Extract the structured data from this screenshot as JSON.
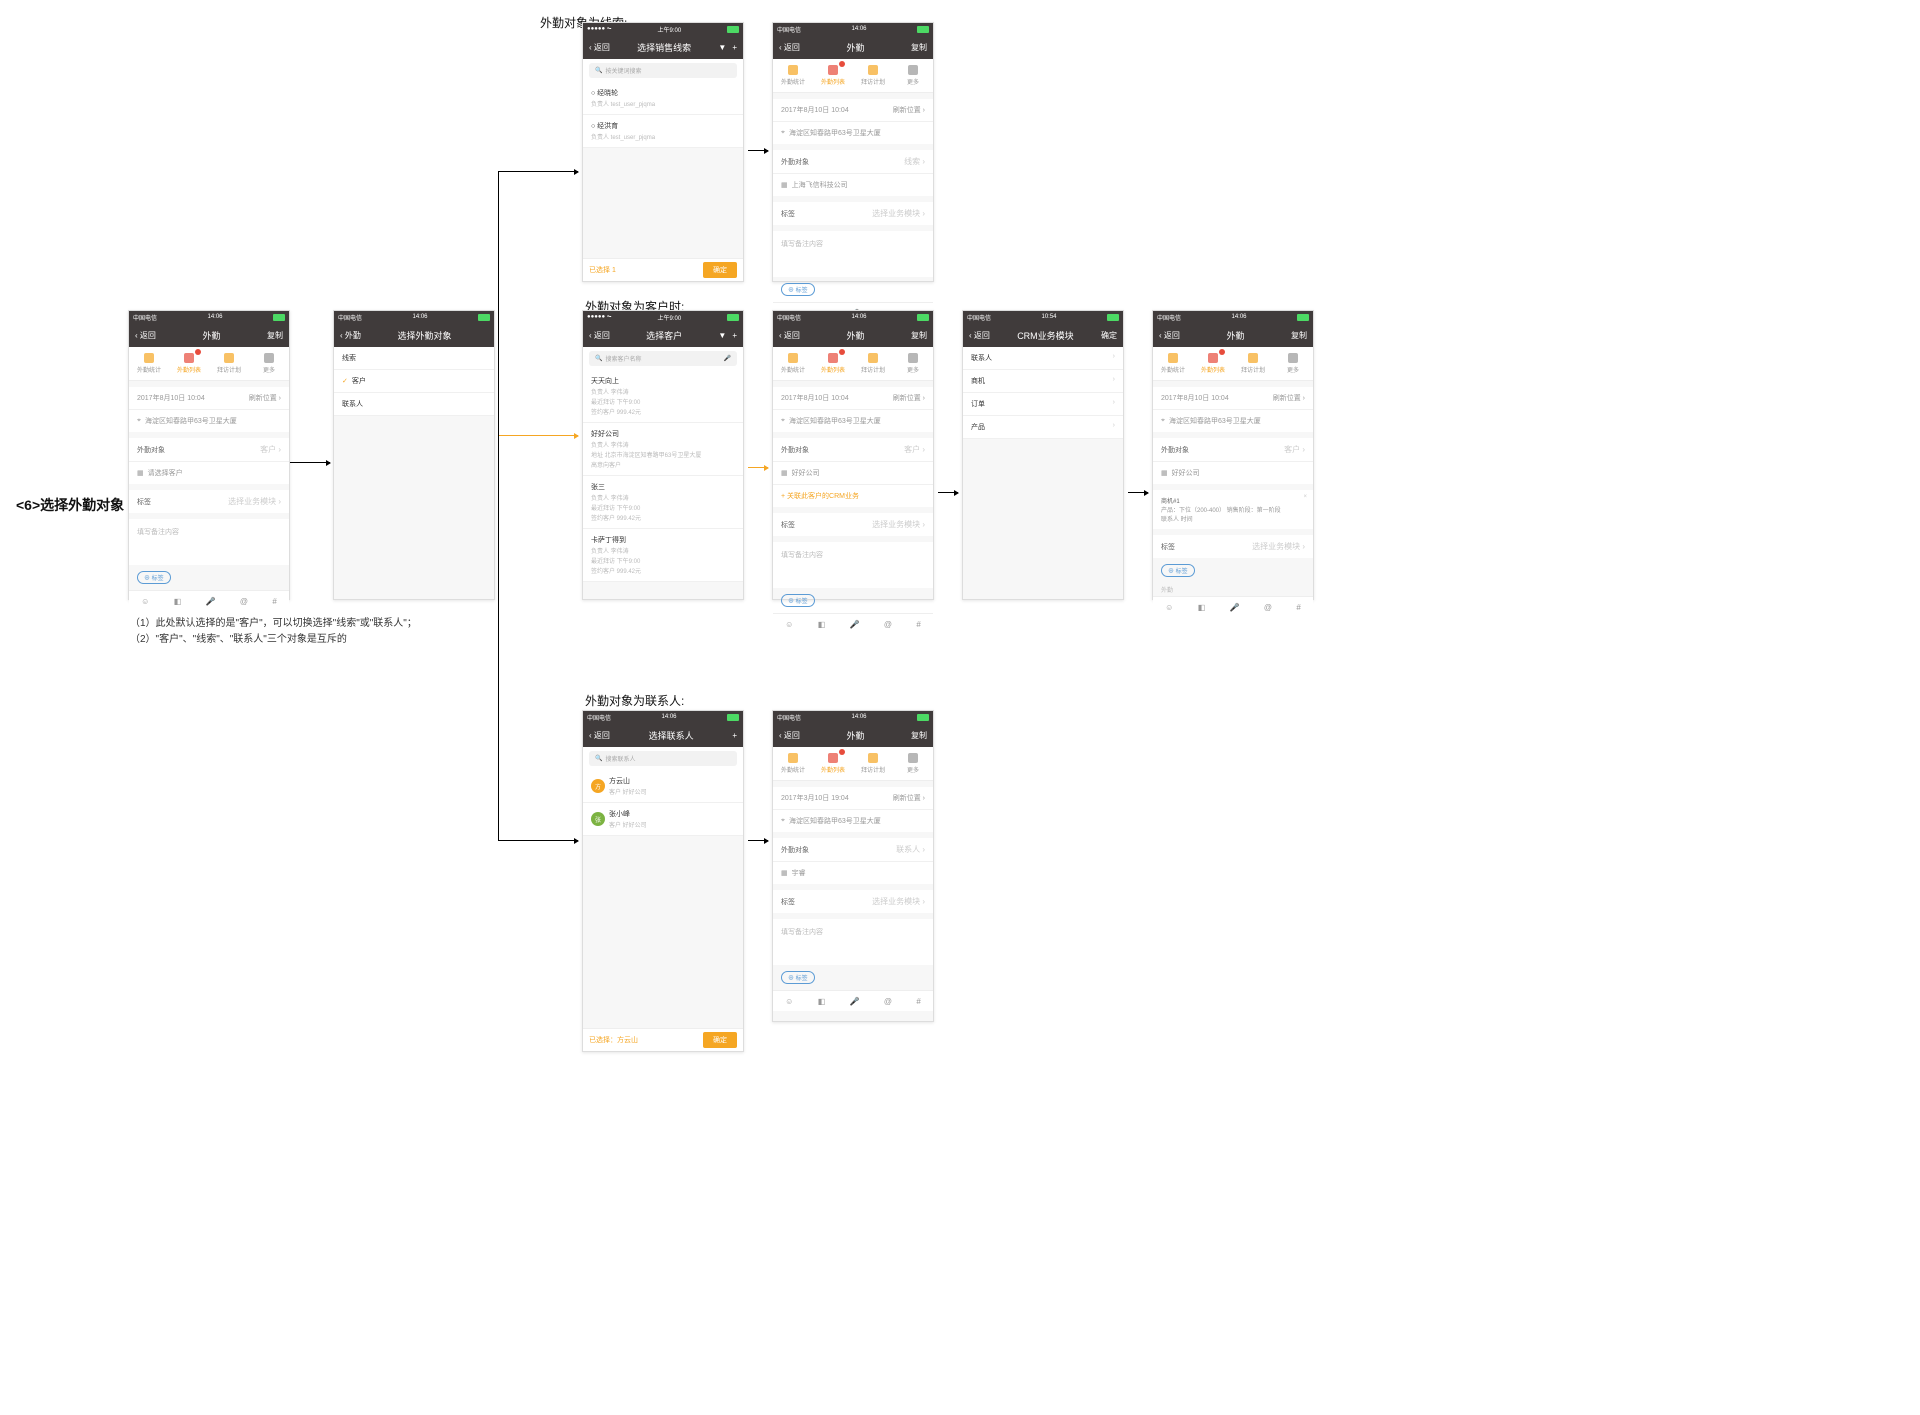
{
  "heading_lead": "外勤对象为线索:",
  "heading_customer": "外勤对象为客户时:",
  "heading_contact": "外勤对象为联系人:",
  "step_label": "<6>选择外勤对象",
  "notes_line1": "（1）此处默认选择的是\"客户\"，可以切换选择\"线索\"或\"联系人\"；",
  "notes_line2": "（2）\"客户\"、\"线索\"、\"联系人\"三个对象是互斥的",
  "status": {
    "carrier": "中国电信",
    "time_am": "上午9:00",
    "time_1406": "14:06",
    "time_1054": "10:54"
  },
  "nav": {
    "back": "返回",
    "waiqin": "外勤",
    "fuzhi": "复制",
    "queding": "确定"
  },
  "tabbar": {
    "t1": "外勤统计",
    "t2": "外勤列表",
    "t3": "拜访计划",
    "t4": "更多"
  },
  "date_row": {
    "date": "2017年8月10日 10:04",
    "refresh": "刷新位置 ›"
  },
  "location": "海淀区知春路甲63号卫星大厦",
  "target": {
    "label": "外勤对象",
    "type_customer": "客户 ›",
    "type_lead": "线索 ›",
    "type_contact": "联系人 ›"
  },
  "placeholder_select_customer": "请选择客户",
  "placeholder_remark": "填写备注内容",
  "tag_label": "标签",
  "mark_remark": "标签",
  "select_label": "选择业务模块 ›",
  "select_target_title": "选择外勤对象",
  "target_options": {
    "lead": "线索",
    "customer": "客户",
    "contact": "联系人"
  },
  "select_lead_title": "选择销售线索",
  "search_lead": "按关键词搜索",
  "leads": [
    {
      "name": "经晓轮",
      "owner": "负责人 test_user_pjqma"
    },
    {
      "name": "经洪育",
      "owner": "负责人 test_user_pjqma"
    }
  ],
  "lead_company": "上海飞信科技公司",
  "select_customer_title": "选择客户",
  "search_customer": "搜索客户名称",
  "customers": [
    {
      "name": "天天向上",
      "line1": "负责人 李伟涛",
      "line2": "最近拜访 下午9:00",
      "line3": "签约客户 999.42元"
    },
    {
      "name": "好好公司",
      "line1": "负责人 李伟涛",
      "line2": "地址 北京市海淀区知春路甲63号卫星大厦",
      "line3": "高意向客户"
    },
    {
      "name": "张三",
      "line1": "负责人 李伟涛",
      "line2": "最近拜访 下午9:00",
      "line3": "签约客户 999.42元"
    },
    {
      "name": "卡萨丁得到",
      "line1": "负责人 李伟涛",
      "line2": "最近拜访 下午9:00",
      "line3": "签约客户 999.42元"
    }
  ],
  "customer_name": "好好公司",
  "add_crm_link": "+ 关联此客户的CRM业务",
  "crm_title": "CRM业务模块",
  "crm_modules": [
    "联系人",
    "商机",
    "订单",
    "产品"
  ],
  "crm_card": {
    "title": "商机#1",
    "line": "产品：下位（200-400）  销售阶段：第一阶段",
    "line2": "联系人   时间"
  },
  "select_contact_title": "选择联系人",
  "search_contact": "搜索联系人",
  "contacts": [
    {
      "name": "方云山",
      "company": "客户 好好公司",
      "color": "#f5a623"
    },
    {
      "name": "张小峰",
      "company": "客户 好好公司",
      "color": "#7cb342"
    }
  ],
  "selected_prefix": "已选择：",
  "selected_contact": "方云山",
  "confirm_btn": "确定",
  "contact_name": "宇睿"
}
